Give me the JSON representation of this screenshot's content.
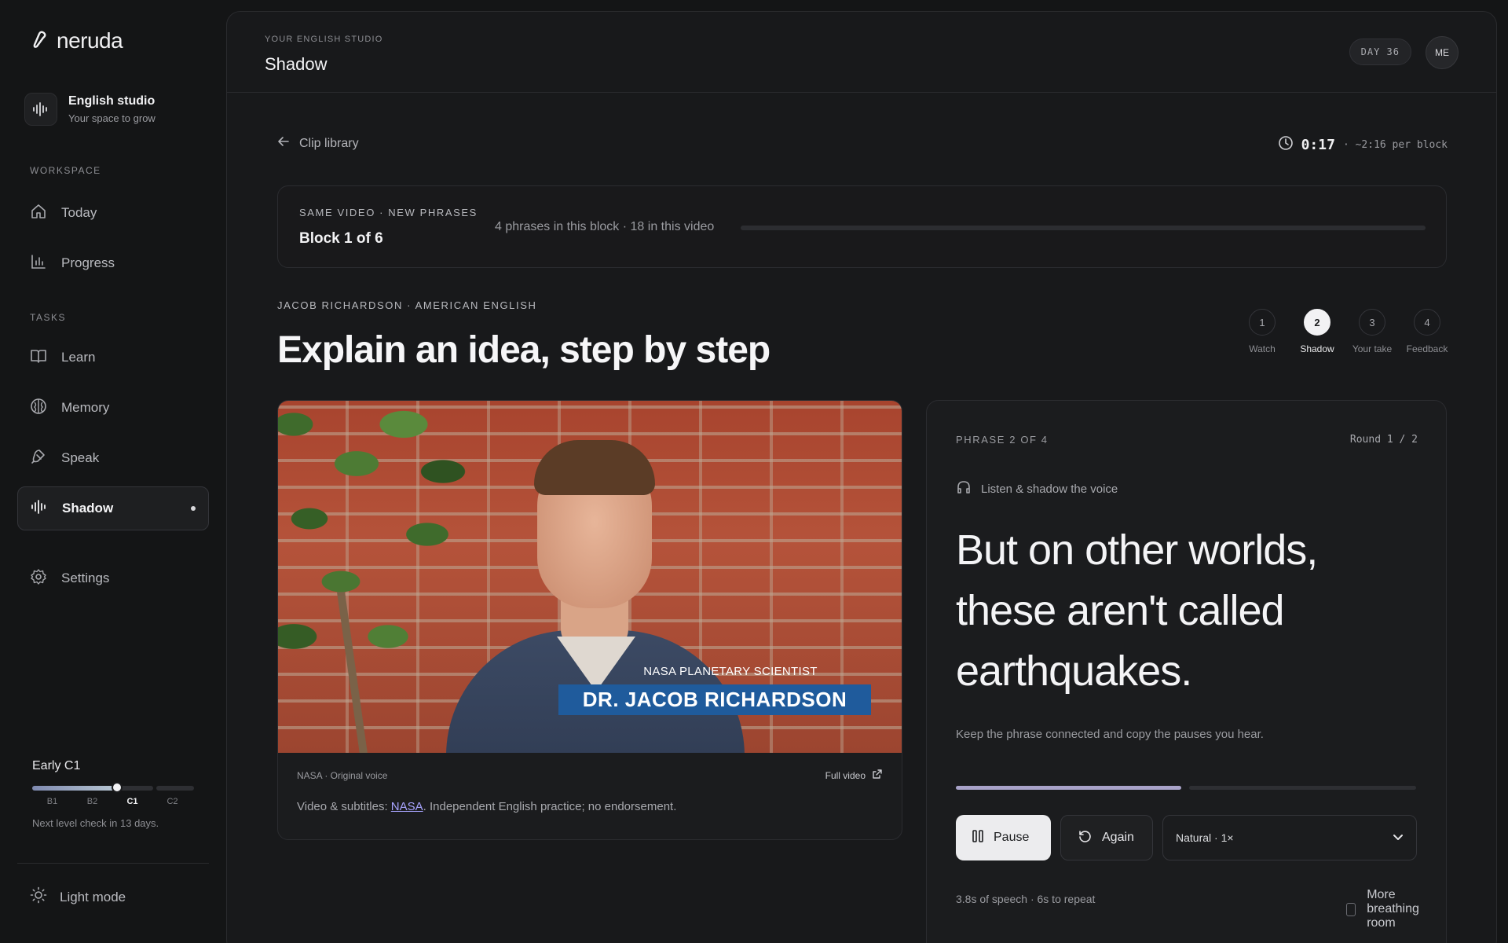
{
  "app": {
    "brand": "neruda",
    "studio_title": "English studio",
    "studio_subtitle": "Your space to grow"
  },
  "sidebar": {
    "workspace_label": "WORKSPACE",
    "tasks_label": "TASKS",
    "workspace_items": [
      {
        "label": "Today",
        "icon": "home-icon"
      },
      {
        "label": "Progress",
        "icon": "bar-chart-icon"
      }
    ],
    "task_items": [
      {
        "label": "Learn",
        "icon": "book-icon"
      },
      {
        "label": "Memory",
        "icon": "brain-icon"
      },
      {
        "label": "Speak",
        "icon": "mic-icon"
      },
      {
        "label": "Shadow",
        "icon": "waveform-icon",
        "active": true
      }
    ],
    "settings_label": "Settings",
    "level": {
      "title": "Early C1",
      "ticks": [
        "B1",
        "B2",
        "C1",
        "C2"
      ],
      "current": "C1",
      "note": "Next level check in 13 days."
    },
    "light_mode_label": "Light mode"
  },
  "header": {
    "eyebrow": "YOUR ENGLISH STUDIO",
    "title": "Shadow",
    "day_badge": "DAY 36",
    "avatar_initials": "ME"
  },
  "nav": {
    "back_label": "Clip library",
    "timer_value": "0:17",
    "timer_sub": "· ~2:16 per block"
  },
  "block": {
    "eyebrow": "SAME VIDEO · NEW PHRASES",
    "title": "Block 1 of 6",
    "meta": "4 phrases in this block · 18 in this video",
    "progress_fraction": 0
  },
  "lesson": {
    "speaker": "JACOB RICHARDSON · AMERICAN ENGLISH",
    "heading": "Explain an idea, step by step",
    "steps": [
      {
        "num": "1",
        "label": "Watch"
      },
      {
        "num": "2",
        "label": "Shadow",
        "active": true
      },
      {
        "num": "3",
        "label": "Your take"
      },
      {
        "num": "4",
        "label": "Feedback"
      }
    ]
  },
  "video": {
    "lower_third_top": "NASA PLANETARY SCIENTIST",
    "lower_third_name": "DR. JACOB RICHARDSON",
    "source_label": "NASA · Original voice",
    "full_video_label": "Full video",
    "credit_prefix": "Video & subtitles: ",
    "credit_link": "NASA",
    "credit_suffix": ". Independent English practice; no endorsement."
  },
  "phrase": {
    "eyebrow": "PHRASE 2 OF 4",
    "round": "Round 1 / 2",
    "listen_label": "Listen & shadow the voice",
    "text": "But on other worlds, these aren't called earthquakes.",
    "hint": "Keep the phrase connected and copy the pauses you hear.",
    "playback_fraction": 0.49,
    "pause_label": "Pause",
    "again_label": "Again",
    "speed_selected": "Natural · 1×",
    "footer_meta": "3.8s of speech · 6s to repeat",
    "breathing_label": "More breathing room",
    "breathing_checked": false
  },
  "colors": {
    "background": "#141516",
    "panel": "#18191b",
    "accent": "#a9a3c9",
    "link": "#a8a4ff",
    "lower_third": "#1f5b9c"
  }
}
